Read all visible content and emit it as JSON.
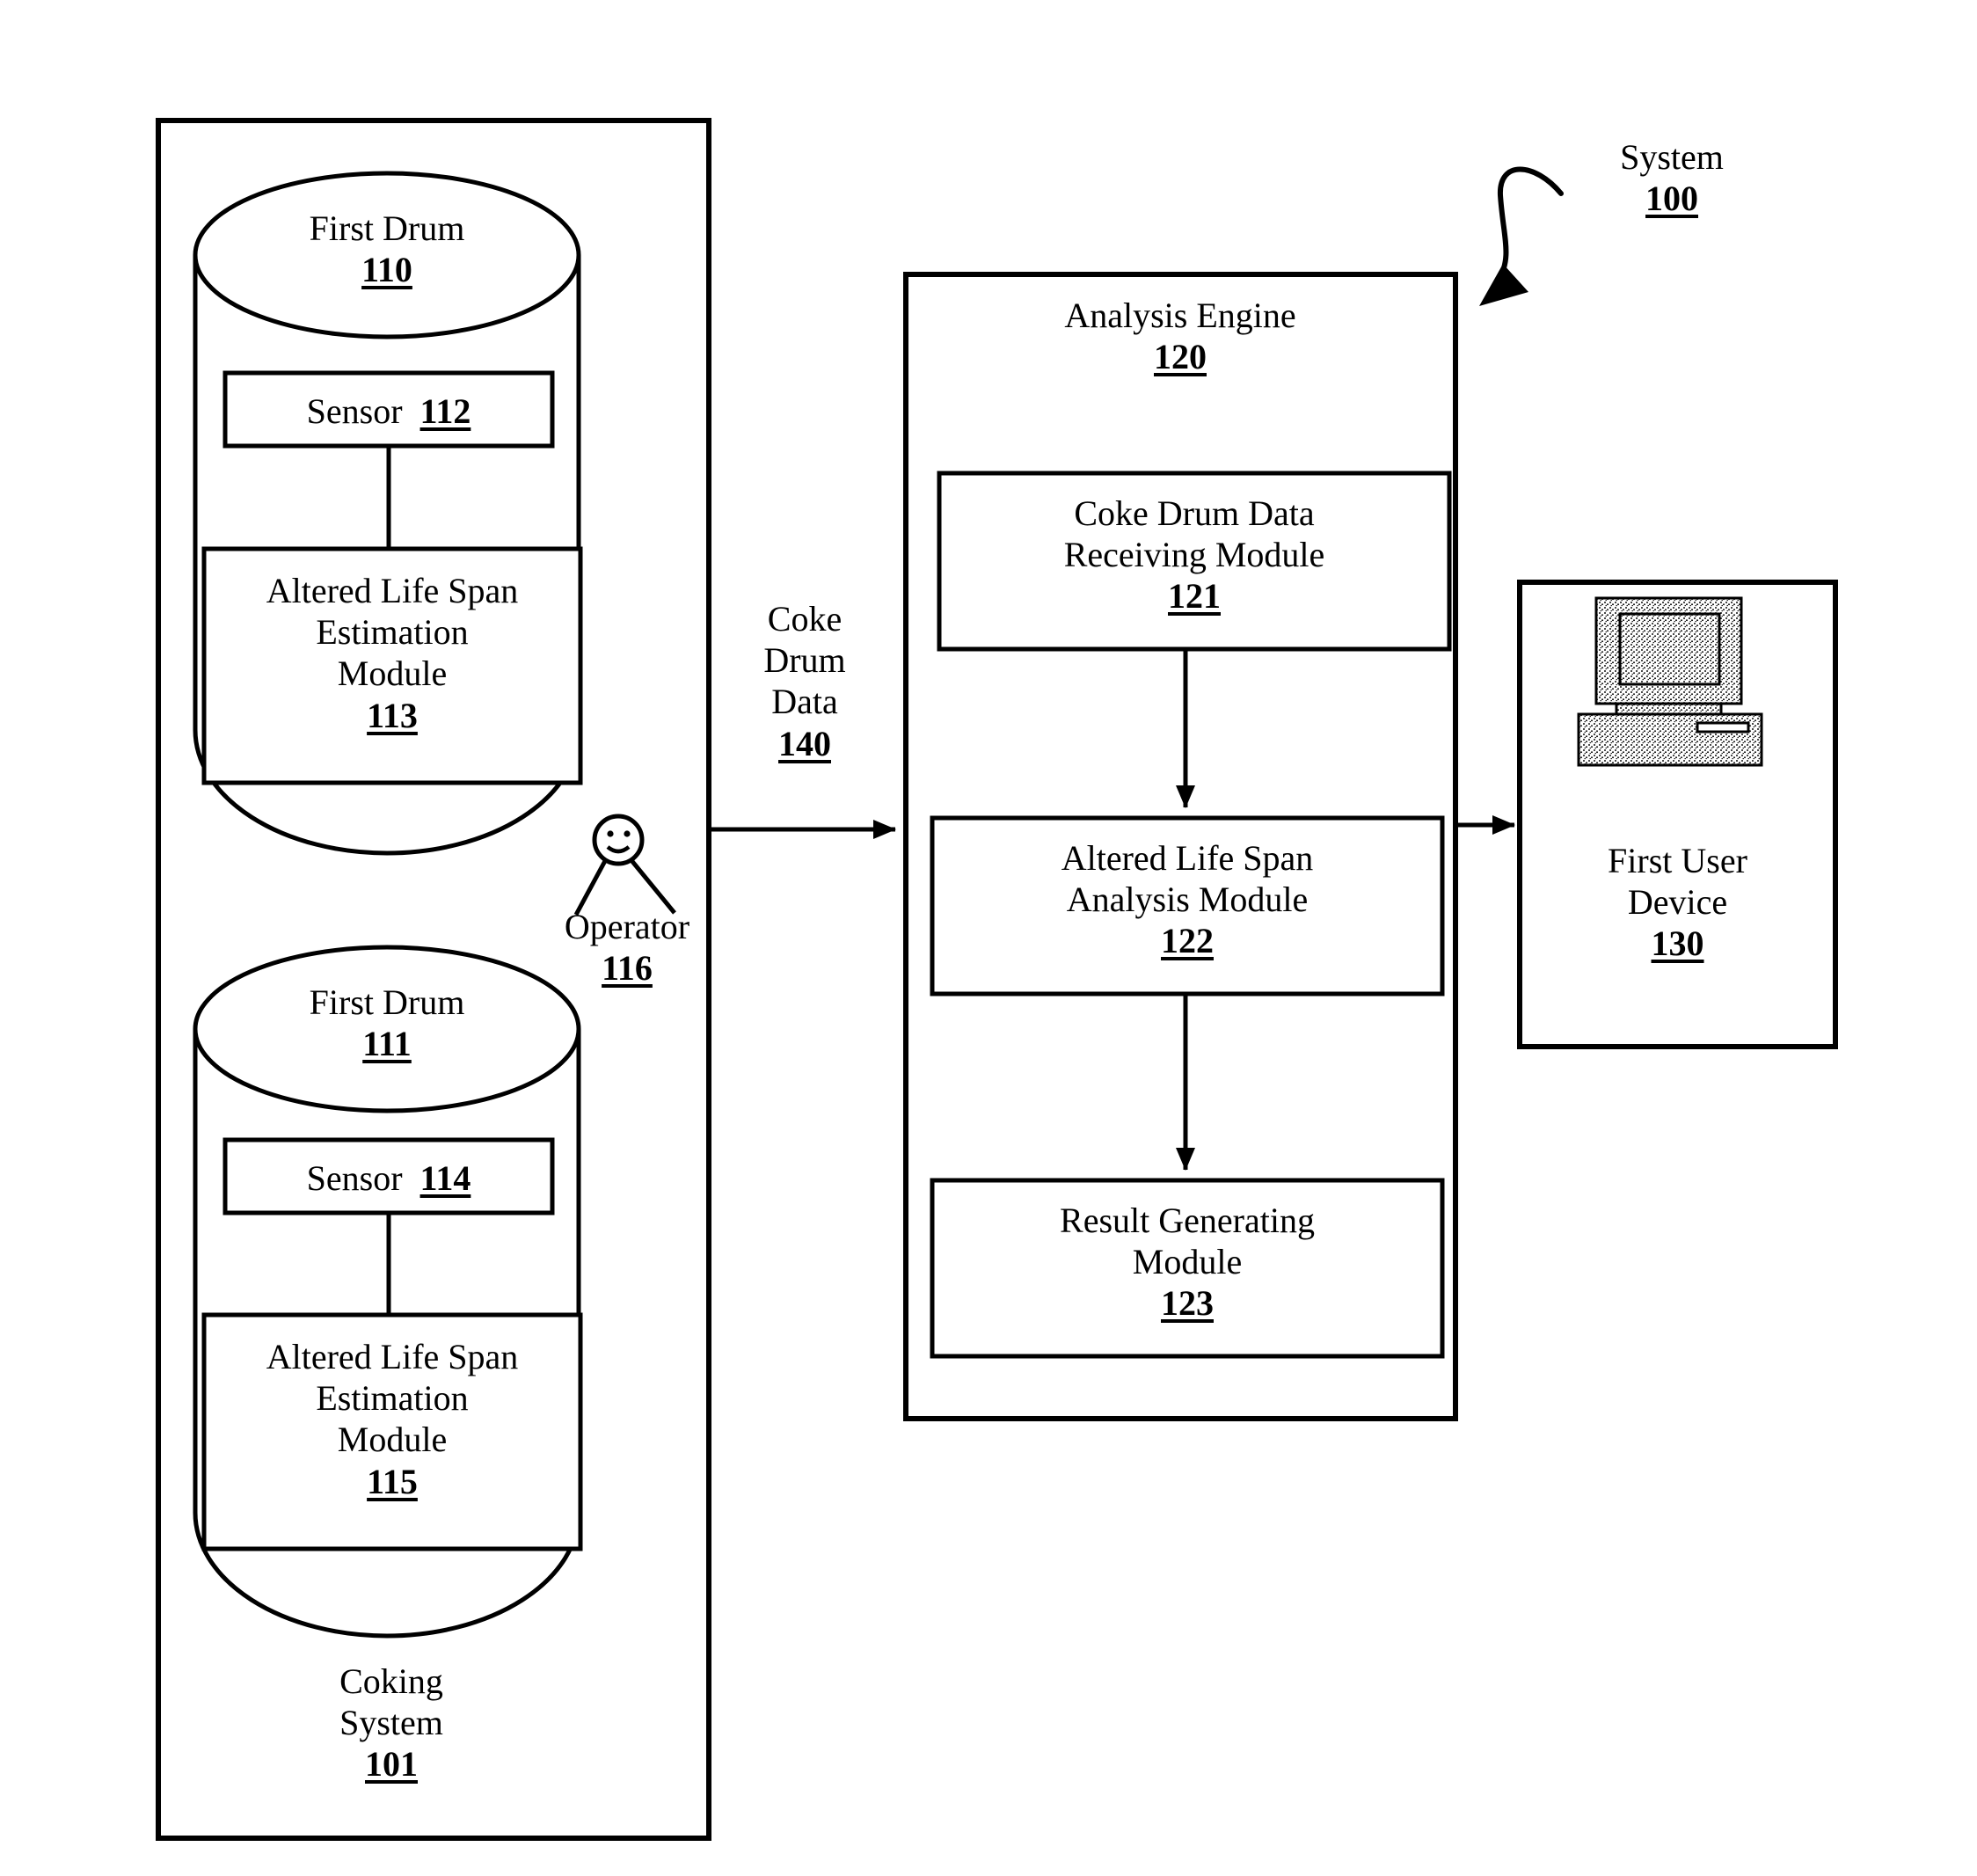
{
  "figure": {
    "system_callout": {
      "label": "System",
      "ref": "100"
    },
    "coking_system": {
      "label_line1": "Coking",
      "label_line2": "System",
      "ref": "101",
      "drums": [
        {
          "name": "First Drum",
          "ref": "110",
          "sensor": {
            "label": "Sensor",
            "ref": "112"
          },
          "module": {
            "line1": "Altered Life Span",
            "line2": "Estimation",
            "line3": "Module",
            "ref": "113"
          }
        },
        {
          "name": "First Drum",
          "ref": "111",
          "sensor": {
            "label": "Sensor",
            "ref": "114"
          },
          "module": {
            "line1": "Altered Life Span",
            "line2": "Estimation",
            "line3": "Module",
            "ref": "115"
          }
        }
      ],
      "operator": {
        "label": "Operator",
        "ref": "116"
      }
    },
    "data_flow": {
      "line1": "Coke",
      "line2": "Drum",
      "line3": "Data",
      "ref": "140"
    },
    "analysis_engine": {
      "title": "Analysis Engine",
      "ref": "120",
      "modules": [
        {
          "line1": "Coke Drum Data",
          "line2": "Receiving Module",
          "ref": "121"
        },
        {
          "line1": "Altered Life Span",
          "line2": "Analysis Module",
          "ref": "122"
        },
        {
          "line1": "Result Generating",
          "line2": "Module",
          "ref": "123"
        }
      ]
    },
    "first_user_device": {
      "line1": "First User",
      "line2": "Device",
      "ref": "130",
      "icon": "desktop-computer-icon"
    }
  }
}
